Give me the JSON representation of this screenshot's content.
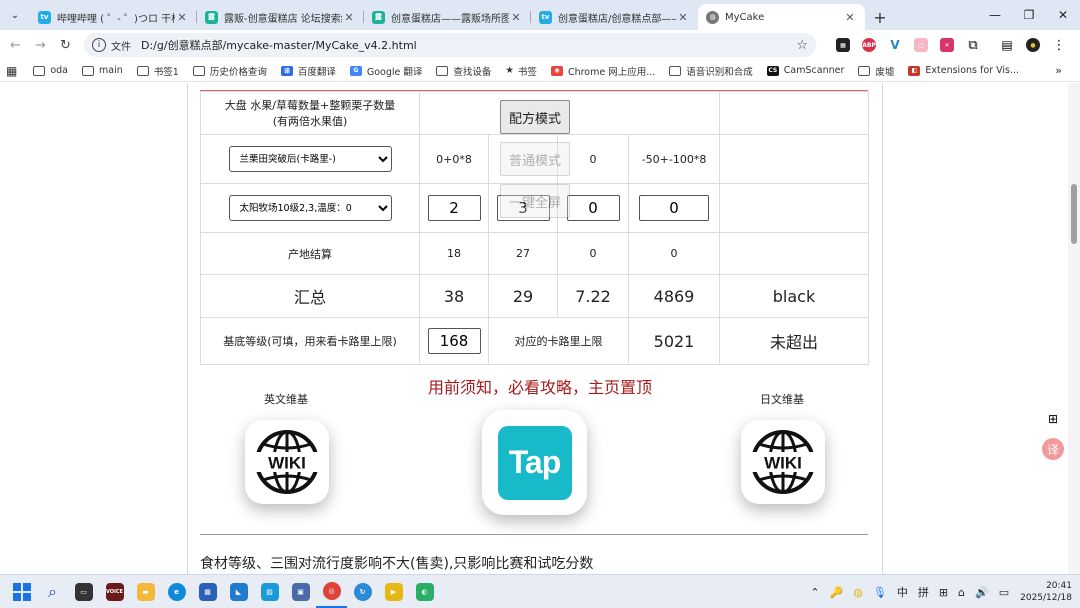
{
  "browser": {
    "tabs": [
      {
        "title": "哔哩哔哩 ( ゜- ゜)つロ 干杯~-bili",
        "favicon_color": "#23ade5",
        "active": false
      },
      {
        "title": "露贩-创意蛋糕店 论坛搜索结果",
        "favicon_color": "#1ab394",
        "active": false
      },
      {
        "title": "创意蛋糕店——露贩场所图鉴",
        "favicon_color": "#1ab394",
        "active": false
      },
      {
        "title": "创意蛋糕店/创意糕点部——进阶",
        "favicon_color": "#23ade5",
        "active": false
      },
      {
        "title": "MyCake",
        "favicon_color": "#666666",
        "active": true
      }
    ],
    "address": {
      "scheme_label": "文件",
      "url": "D:/g/创意糕点部/mycake-master/MyCake_v4.2.html"
    },
    "bookmarks": [
      "oda",
      "main",
      "书签1",
      "历史价格查询",
      "百度翻译",
      "Google 翻译",
      "查找设备",
      "书签",
      "Chrome 网上应用...",
      "语音识别和合成",
      "CamScanner",
      "废墟",
      "Extensions for Vis..."
    ]
  },
  "calc": {
    "row_fruit": {
      "label_line1": "大盘 水果/草莓数量+整颗栗子数量",
      "label_line2": "(有两倍水果值)"
    },
    "row_field": {
      "select_value": "兰栗田突破后(卡路里-)",
      "v1": "0+0*8",
      "v3": "0",
      "v4": "-50+-100*8"
    },
    "row_ranch": {
      "select_value": "太阳牧场10级2,3,温度：0",
      "in1": "2",
      "in2": "3",
      "in3": "0",
      "in4": "0"
    },
    "row_origin": {
      "label": "产地结算",
      "v1": "18",
      "v2": "27",
      "v3": "0",
      "v4": "0"
    },
    "row_total": {
      "label": "汇总",
      "v1": "38",
      "v2": "29",
      "v3": "7.22",
      "v4": "4869",
      "v5": "black"
    },
    "row_base": {
      "label": "基底等级(可填，用来看卡路里上限)",
      "input": "168",
      "mid_label": "对应的卡路里上限",
      "value": "5021",
      "status": "未超出"
    }
  },
  "overlay": {
    "recipe_mode": "配方模式",
    "normal_mode": "普通模式",
    "fullscreen": "一键全屏"
  },
  "notice": "用前须知，必看攻略，主页置顶",
  "links": {
    "en_wiki": "英文维基",
    "jp_wiki": "日文维基",
    "wiki_text": "WIKI",
    "tap_text": "Tap"
  },
  "bottom_text": "食材等级、三围对流行度影响不大(售卖),只影响比赛和试吃分数",
  "taskbar": {
    "ime1": "中",
    "ime2": "拼",
    "time": "20:41",
    "date": "2025/12/18"
  },
  "colors": {
    "notice": "#a51b1b",
    "tap_bg": "#18b9c8",
    "accent_line": "#e06464"
  }
}
